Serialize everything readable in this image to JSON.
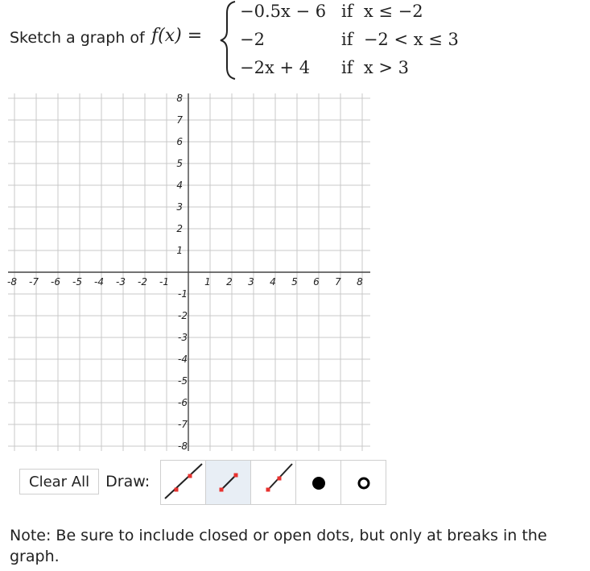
{
  "question": {
    "prompt": "Sketch a graph of",
    "function_lhs": "f(x) =",
    "cases": [
      {
        "expr": "−0.5x − 6",
        "cond": "if  x ≤ −2"
      },
      {
        "expr": "−2",
        "cond": "if  −2 < x ≤ 3"
      },
      {
        "expr": "−2x + 4",
        "cond": "if  x > 3"
      }
    ]
  },
  "graph": {
    "x_ticks": [
      "-8",
      "-7",
      "-6",
      "-5",
      "-4",
      "-3",
      "-2",
      "-1",
      "1",
      "2",
      "3",
      "4",
      "5",
      "6",
      "7",
      "8"
    ],
    "y_ticks_pos": [
      "8",
      "7",
      "6",
      "5",
      "4",
      "3",
      "2",
      "1"
    ],
    "y_ticks_neg": [
      "-1",
      "-2",
      "-3",
      "-4",
      "-5",
      "-6",
      "-7",
      "-8"
    ],
    "grid_color": "#c8c8c8",
    "axis_color": "#444444"
  },
  "toolbar": {
    "clear_label": "Clear All",
    "draw_label": "Draw:",
    "tools": [
      {
        "name": "line-tool-icon",
        "selected": false
      },
      {
        "name": "segment-tool-icon",
        "selected": true
      },
      {
        "name": "ray-tool-icon",
        "selected": false
      },
      {
        "name": "closed-dot-icon",
        "selected": false
      },
      {
        "name": "open-dot-icon",
        "selected": false
      }
    ],
    "accent": "#e8322f"
  },
  "note": "Note: Be sure to include closed or open dots, but only at breaks in the graph."
}
